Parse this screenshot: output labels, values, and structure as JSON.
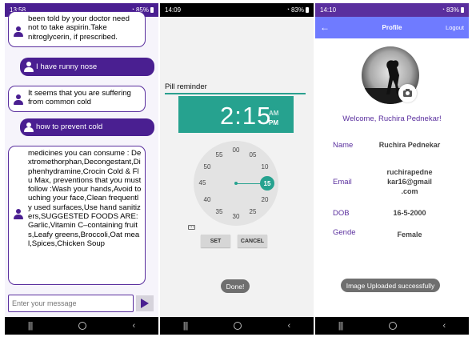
{
  "screen1": {
    "status": {
      "time": "13:58",
      "battery": "85%"
    },
    "messages": [
      {
        "sender": "bot",
        "text": "been told by your doctor need not to take aspirin.Take nitroglycerin, if prescribed."
      },
      {
        "sender": "user",
        "text": "I have runny nose"
      },
      {
        "sender": "bot",
        "text": "It seems that you are suffering from common cold"
      },
      {
        "sender": "user",
        "text": "how to prevent cold"
      },
      {
        "sender": "bot",
        "text": "medicines you can consume : Dextromethorphan,Decongestant,Diphenhydramine,Crocin Cold & Flu Max, preventions that you must follow :Wash your hands,Avoid touching your face,Clean frequently used surfaces,Use hand sanitizers,SUGGESTED FOODS ARE:Garlic,Vitamin C–containing fruits,Leafy greens,Broccoli,Oat meal,Spices,Chicken Soup"
      }
    ],
    "input_placeholder": "Enter your message"
  },
  "screen2": {
    "status": {
      "time": "14:09",
      "battery": "83%"
    },
    "field_label": "Pill reminder",
    "time_display": "2:15",
    "am_label": "AM",
    "pm_label": "PM",
    "dial_numbers": [
      "00",
      "05",
      "10",
      "15",
      "20",
      "25",
      "30",
      "35",
      "40",
      "45",
      "50",
      "55"
    ],
    "selected_minute": "15",
    "set_label": "SET",
    "cancel_label": "CANCEL",
    "toast": "Done!"
  },
  "screen3": {
    "status": {
      "time": "14:10",
      "battery": "83%"
    },
    "title": "Profile",
    "logout_label": "Logout",
    "welcome": "Welcome, Ruchira Pednekar!",
    "fields": [
      {
        "label": "Name",
        "value": "Ruchira Pednekar"
      },
      {
        "label": "Email",
        "value": "ruchirapedne kar16@gmail .com"
      },
      {
        "label": "DOB",
        "value": "16-5-2000"
      },
      {
        "label": "Gende",
        "value": "Female"
      }
    ],
    "toast": "Image Uploaded successfully"
  },
  "colors": {
    "chat_accent": "#4a1f91",
    "picker_accent": "#26a28f",
    "appbar": "#6f7bff",
    "status_bar_chat": "#4a1f91",
    "status_bar_picker": "#000000"
  },
  "icons": [
    "person-icon",
    "send-icon",
    "back-arrow-icon",
    "camera-icon",
    "keyboard-icon",
    "wifi-icon",
    "battery-icon",
    "nav-recents-icon",
    "nav-home-icon",
    "nav-back-icon"
  ]
}
